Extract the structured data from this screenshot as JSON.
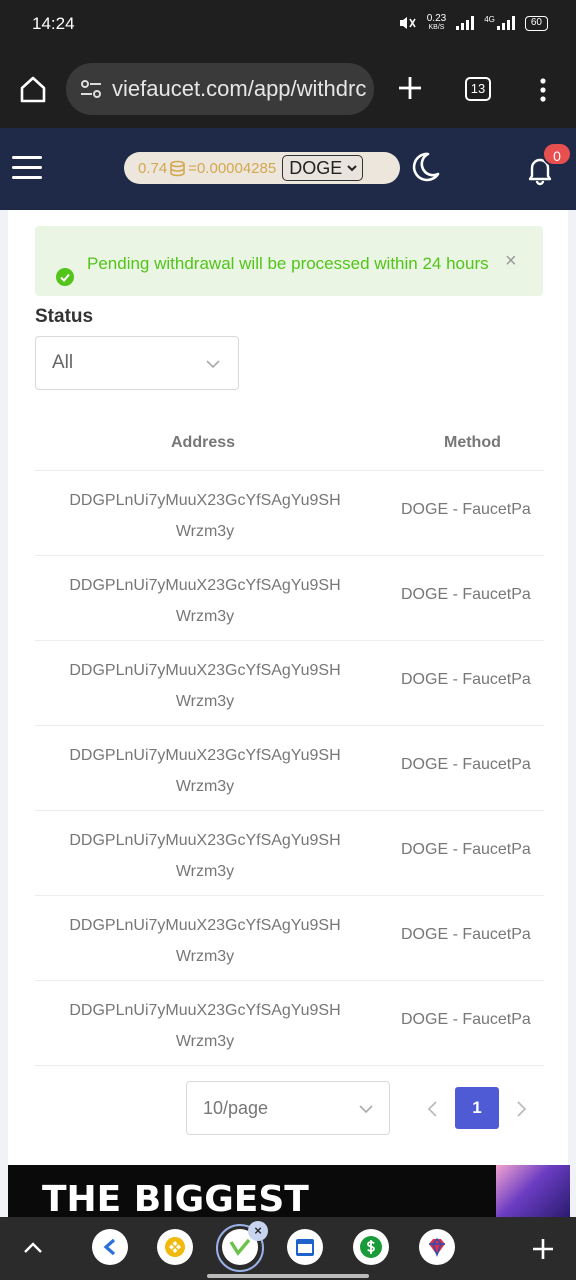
{
  "statusbar": {
    "time": "14:24",
    "speed_value": "0.23",
    "speed_unit": "KB/S",
    "network_type": "4G",
    "battery": "60"
  },
  "browser": {
    "url": "viefaucet.com/app/withdrc",
    "tab_count": "13"
  },
  "header": {
    "balance_amount": "0.74",
    "balance_converted": "=0.00004285",
    "currency": "DOGE",
    "notification_count": "0"
  },
  "alert": {
    "message": "Pending withdrawal will be processed within 24 hours",
    "close_symbol": "×"
  },
  "filter": {
    "status_label": "Status",
    "status_value": "All"
  },
  "table": {
    "columns": [
      "Address",
      "Method"
    ],
    "rows": [
      {
        "address_line1": "DDGPLnUi7yMuuX23GcYfSAgYu9SH",
        "address_line2": "Wrzm3y",
        "method": "DOGE - FaucetPa"
      },
      {
        "address_line1": "DDGPLnUi7yMuuX23GcYfSAgYu9SH",
        "address_line2": "Wrzm3y",
        "method": "DOGE - FaucetPa"
      },
      {
        "address_line1": "DDGPLnUi7yMuuX23GcYfSAgYu9SH",
        "address_line2": "Wrzm3y",
        "method": "DOGE - FaucetPa"
      },
      {
        "address_line1": "DDGPLnUi7yMuuX23GcYfSAgYu9SH",
        "address_line2": "Wrzm3y",
        "method": "DOGE - FaucetPa"
      },
      {
        "address_line1": "DDGPLnUi7yMuuX23GcYfSAgYu9SH",
        "address_line2": "Wrzm3y",
        "method": "DOGE - FaucetPa"
      },
      {
        "address_line1": "DDGPLnUi7yMuuX23GcYfSAgYu9SH",
        "address_line2": "Wrzm3y",
        "method": "DOGE - FaucetPa"
      },
      {
        "address_line1": "DDGPLnUi7yMuuX23GcYfSAgYu9SH",
        "address_line2": "Wrzm3y",
        "method": "DOGE - FaucetPa"
      }
    ]
  },
  "pagination": {
    "page_size": "10/page",
    "current_page": "1"
  },
  "ad": {
    "text": "THE BIGGEST"
  },
  "tabbar": {
    "tabs": [
      "back-arrow-tab-icon",
      "binance-tab-icon",
      "viefaucet-tab-icon",
      "calendar-tab-icon",
      "dollar-tab-icon",
      "gem-tab-icon"
    ],
    "close_symbol": "×"
  },
  "colors": {
    "header_bg": "#1e2a47",
    "accent": "#4f5bd5",
    "success": "#52c41a",
    "badge": "#e84f4f"
  }
}
